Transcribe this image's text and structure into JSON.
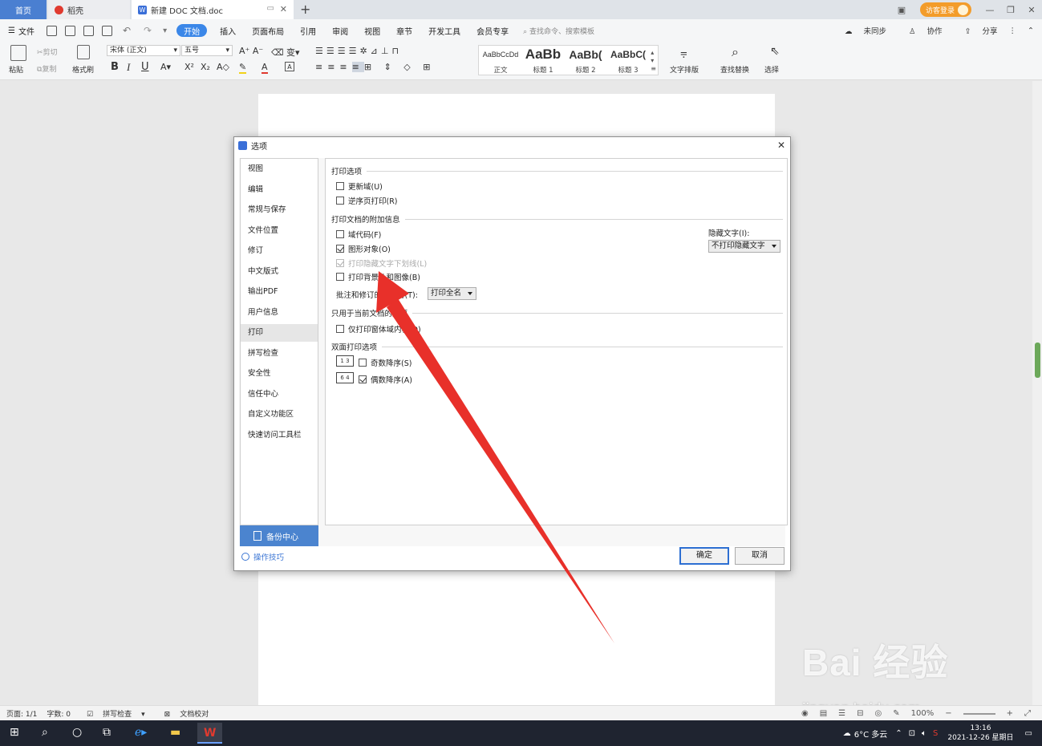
{
  "tabs": {
    "home": "首页",
    "daoke": "稻壳",
    "doc": "新建 DOC 文档.doc",
    "new_tab": "+"
  },
  "titlebar": {
    "visitor_login": "访客登录"
  },
  "menu": {
    "file": "文件",
    "items": [
      "开始",
      "插入",
      "页面布局",
      "引用",
      "审阅",
      "视图",
      "章节",
      "开发工具",
      "会员专享"
    ],
    "search": "查找命令、搜索模板",
    "right": [
      "未同步",
      "协作",
      "分享"
    ]
  },
  "ribbon": {
    "paste": "粘贴",
    "cut": "剪切",
    "copy": "复制",
    "format_painter": "格式刷",
    "font_name": "宋体 (正文)",
    "font_size": "五号",
    "bold": "B",
    "italic": "I",
    "underline": "U",
    "styles": [
      {
        "preview": "AaBbCcDd",
        "label": "正文"
      },
      {
        "preview": "AaBb",
        "label": "标题 1"
      },
      {
        "preview": "AaBb(",
        "label": "标题 2"
      },
      {
        "preview": "AaBbC(",
        "label": "标题 3"
      }
    ],
    "text_layout": "文字排版",
    "find_replace": "查找替换",
    "select": "选择"
  },
  "dialog": {
    "title": "选项",
    "nav": [
      "视图",
      "编辑",
      "常规与保存",
      "文件位置",
      "修订",
      "中文版式",
      "输出PDF",
      "用户信息",
      "打印",
      "拼写检查",
      "安全性",
      "信任中心",
      "自定义功能区",
      "快速访问工具栏"
    ],
    "backup": "备份中心",
    "tips": "操作技巧",
    "print_options": "打印选项",
    "update_fields": "更新域(U)",
    "reverse_order": "逆序页打印(R)",
    "additional_info": "打印文档的附加信息",
    "field_codes": "域代码(F)",
    "drawing_objects": "图形对象(O)",
    "hidden_underline": "打印隐藏文字下划线(L)",
    "background": "打印背景色和图像(B)",
    "hidden_text_label": "隐藏文字(I):",
    "hidden_text_value": "不打印隐藏文字",
    "reviewer_label": "批注和修订的审阅者(T):",
    "reviewer_value": "打印全名",
    "current_doc": "只用于当前文档的选项",
    "form_only": "仅打印窗体域内容(D)",
    "duplex": "双面打印选项",
    "odd_desc": "奇数降序(S)",
    "even_desc": "偶数降序(A)",
    "ok": "确定",
    "cancel": "取消"
  },
  "statusbar": {
    "page": "页面: 1/1",
    "words": "字数: 0",
    "spell": "拼写检查",
    "proof": "文档校对",
    "zoom": "100%"
  },
  "taskbar": {
    "weather": "6°C 多云",
    "time": "13:16",
    "date": "2021-12-26 星期日"
  },
  "watermark": {
    "brand": "Bai 经验",
    "url": "jingyan.baidu.com"
  },
  "colors": {
    "accent": "#3b87e8",
    "annotation_arrow": "#e8302a"
  }
}
